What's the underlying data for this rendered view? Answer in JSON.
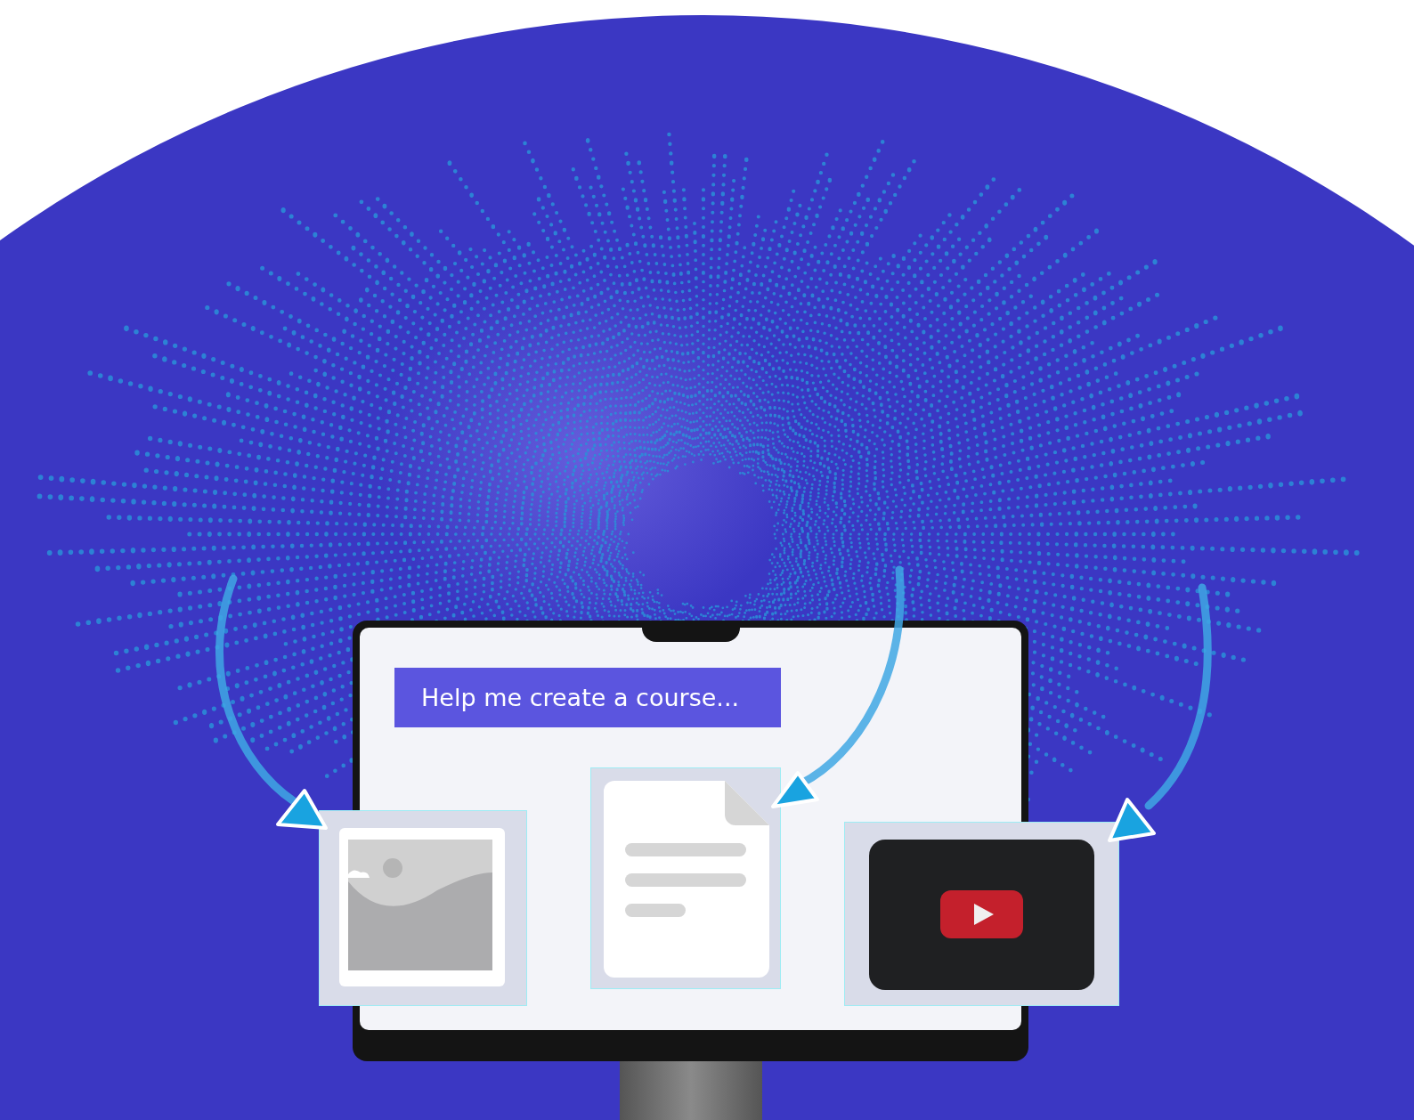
{
  "prompt": {
    "text": "Help me create a course..."
  },
  "cards": [
    {
      "kind": "image"
    },
    {
      "kind": "document"
    },
    {
      "kind": "video"
    }
  ]
}
